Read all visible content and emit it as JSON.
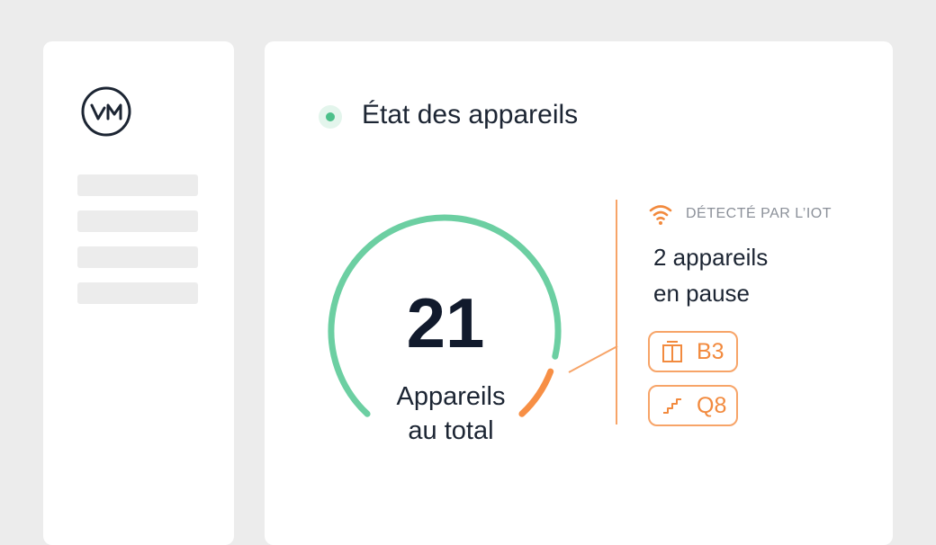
{
  "panel": {
    "title": "État des appareils"
  },
  "gauge": {
    "total": "21",
    "label_line1": "Appareils",
    "label_line2": "au total",
    "paused_fraction": 0.095,
    "colors": {
      "active": "#6ccfa2",
      "paused": "#f78f45"
    }
  },
  "iot": {
    "label": "DÉTECTÉ PAR L’IOT",
    "summary_line1": "2 appareils",
    "summary_line2": "en pause"
  },
  "tags": [
    {
      "label": "B3",
      "icon": "elevator-icon"
    },
    {
      "label": "Q8",
      "icon": "stairs-icon"
    }
  ],
  "colors": {
    "accent_green": "#4cc08a",
    "accent_orange": "#f28a3e",
    "text_dark": "#1c2533"
  }
}
